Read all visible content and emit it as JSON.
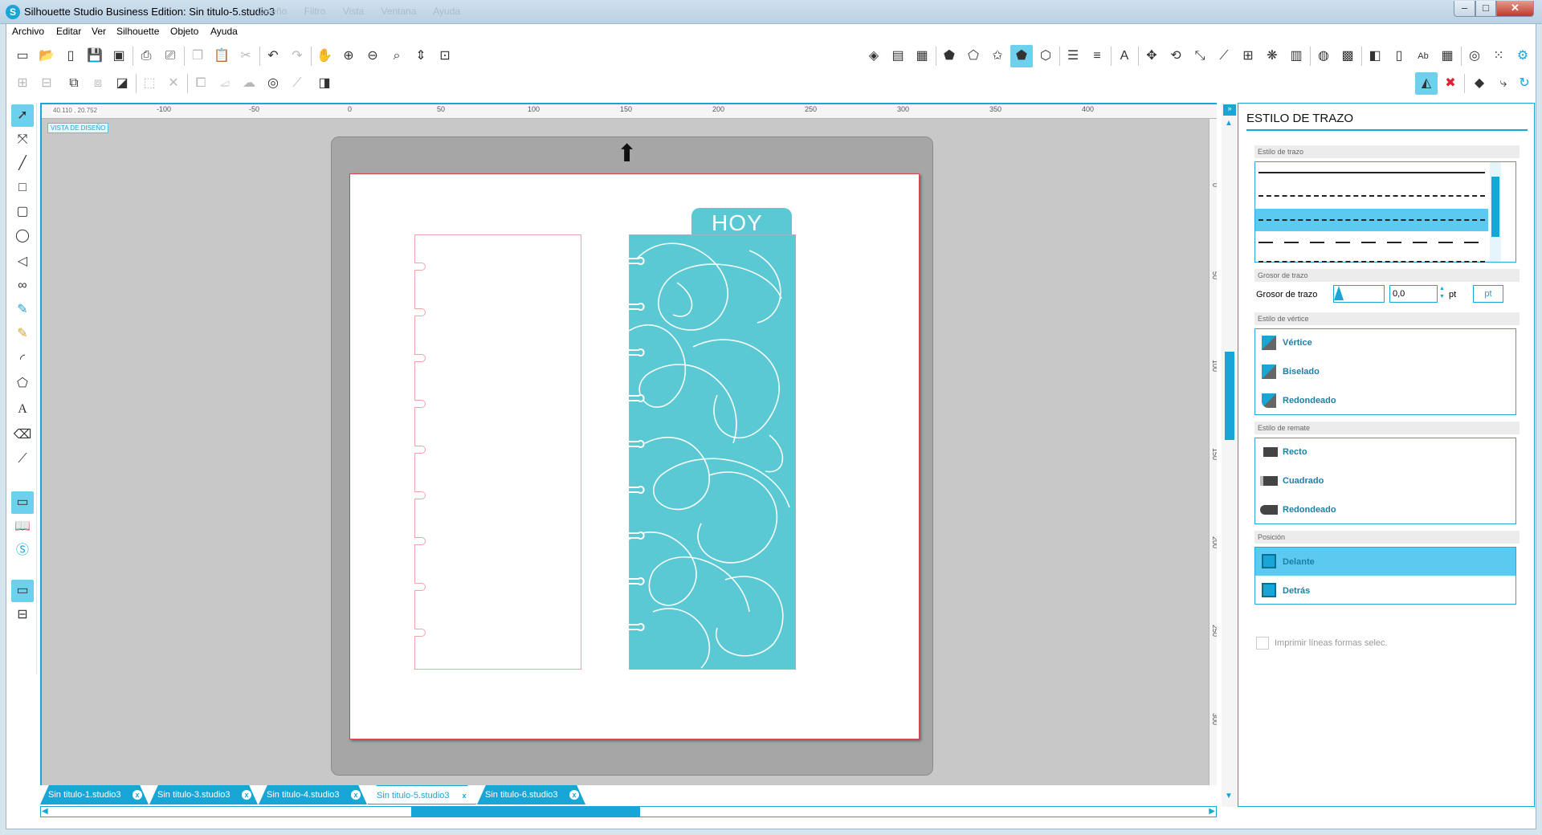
{
  "window": {
    "title": "Silhouette Studio Business Edition: Sin titulo-5.studio3",
    "ghost_menu": "Diseño  Filtro  Vista  Ventana  Ayuda"
  },
  "menu": [
    "Archivo",
    "Editar",
    "Ver",
    "Silhouette",
    "Objeto",
    "Ayuda"
  ],
  "toolbar": {
    "row1_left_icons": [
      "new-icon",
      "open-icon",
      "template-icon",
      "save-icon",
      "save-library-icon",
      "print-icon",
      "print-cut-icon",
      "copy-icon",
      "paste-icon",
      "cut-icon",
      "undo-icon",
      "redo-icon",
      "pan-icon",
      "zoom-in-icon",
      "zoom-out-icon",
      "zoom-select-icon",
      "zoom-drag-icon",
      "fit-page-icon"
    ],
    "row1_right_icons": [
      "fill-icon",
      "gradient-icon",
      "pattern-icon",
      "line-color-icon",
      "line-style-icon",
      "star-icon",
      "shape-icon",
      "offset-icon",
      "align-icon",
      "replicate-icon",
      "text-icon",
      "transform-icon",
      "rotate-icon",
      "scale-icon",
      "knife-icon",
      "nest-icon",
      "trace-icon",
      "sketch-icon",
      "store-icon",
      "library-icon",
      "cut-settings-icon",
      "send-icon",
      "ab-icon",
      "grid-icon",
      "pixscan-icon",
      "dots-icon",
      "gear-icon"
    ],
    "row2_icons": [
      "group-icon",
      "ungroup-icon",
      "compound-icon",
      "release-compound-icon",
      "weld-icon",
      "subtract-icon",
      "intersect-icon",
      "crop-icon",
      "modify-icon",
      "offset2-icon",
      "wand-icon",
      "3d-icon"
    ],
    "row2_right_icons": [
      "line-style-active-icon",
      "no-cut-icon",
      "eraser-panel-icon",
      "send-to-icon",
      "refresh-icon"
    ]
  },
  "tools": [
    "select-icon",
    "point-edit-icon",
    "line-icon",
    "rectangle-icon",
    "rounded-rectangle-icon",
    "ellipse-icon",
    "polygon-draw-icon",
    "curve-icon",
    "freehand-icon",
    "smooth-freehand-icon",
    "arc-icon",
    "regular-polygon-icon",
    "text-tool-icon",
    "eraser-icon",
    "knife-tool-icon",
    "design-view-icon",
    "library-view-icon",
    "store-view-icon",
    "window-icon",
    "split-view-icon"
  ],
  "canvas": {
    "coord": "40.110 , 20.752",
    "view_label": "VISTA DE DISEÑO",
    "hoy": "HOY",
    "h_ruler": [
      "-100",
      "-50",
      "0",
      "50",
      "100",
      "150",
      "200",
      "250",
      "300",
      "350",
      "400"
    ],
    "v_ruler": [
      "0",
      "50",
      "100",
      "150",
      "200",
      "250",
      "300"
    ]
  },
  "panel": {
    "title": "ESTILO DE TRAZO",
    "sec_trazo": "Estilo de trazo",
    "sec_grosor": "Grosor de trazo",
    "grosor_label": "Grosor de trazo",
    "grosor_value": "0,0",
    "grosor_unit": "pt",
    "unit_button": "pt",
    "sec_vertice": "Estilo de vértice",
    "vertice": [
      "Vértice",
      "Biselado",
      "Redondeado"
    ],
    "sec_remate": "Estilo de remate",
    "remate": [
      "Recto",
      "Cuadrado",
      "Redondeado"
    ],
    "sec_posicion": "Posición",
    "posicion": [
      "Delante",
      "Detrás"
    ],
    "imprimir": "Imprimir líneas formas selec."
  },
  "tabs": [
    "Sin titulo-1.studio3",
    "Sin titulo-3.studio3",
    "Sin titulo-4.studio3",
    "Sin titulo-5.studio3",
    "Sin titulo-6.studio3"
  ],
  "colors": {
    "accent": "#19a5d6",
    "divider": "#5bc9d3",
    "cut_line": "#f0a6a6"
  }
}
